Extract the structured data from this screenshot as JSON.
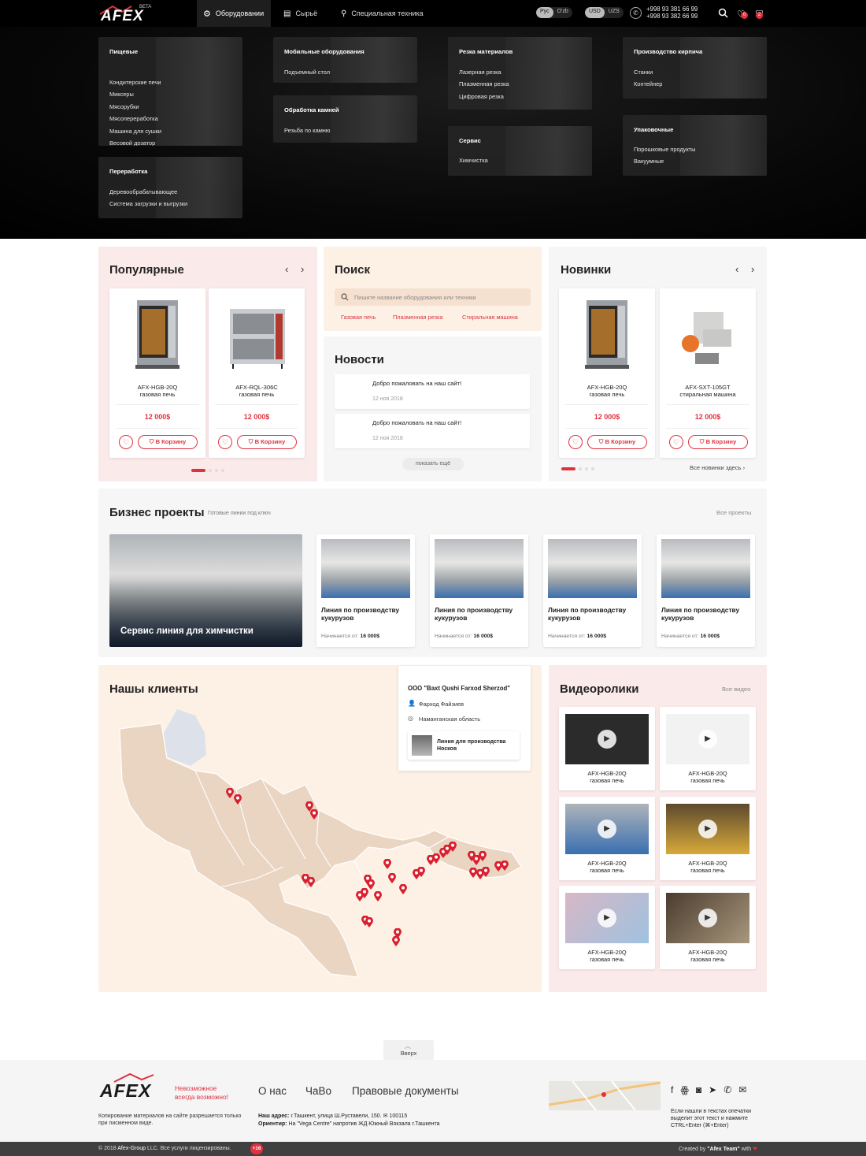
{
  "header": {
    "logo": "AFEX",
    "logo_badge": "BETA",
    "nav": [
      {
        "label": "Оборудовании",
        "icon": "equipment-icon"
      },
      {
        "label": "Сырьё",
        "icon": "book-icon"
      },
      {
        "label": "Специальная техника",
        "icon": "tech-icon"
      }
    ],
    "lang": [
      "Рус",
      "O'zb"
    ],
    "currency": [
      "USD",
      "UZS"
    ],
    "phones": [
      "+998 93 381 66 99",
      "+998 93 382 66 99"
    ],
    "fav_count": "0",
    "cart_count": "2"
  },
  "mega_menu": [
    {
      "title": "Пищевые",
      "items": [
        "Кондитерские печи",
        "Миксеры",
        "Мясорубки",
        "Мясопереработка",
        "Машина для сушки",
        "Весовой дозатор"
      ]
    },
    {
      "title": "Переработка",
      "items": [
        "Деревообрабатывающее",
        "Система загрузки и выгрузки"
      ]
    },
    {
      "title": "Мобильные оборудования",
      "items": [
        "Подъемный стол"
      ]
    },
    {
      "title": "Обработка камней",
      "items": [
        "Резьба по камню"
      ]
    },
    {
      "title": "Резка материалов",
      "items": [
        "Лазерная резка",
        "Плазменная резка",
        "Цифровая резка"
      ]
    },
    {
      "title": "Сервис",
      "items": [
        "Химчистка"
      ]
    },
    {
      "title": "Производство кирпича",
      "items": [
        "Станки",
        "Контейнер"
      ]
    },
    {
      "title": "Упаковочные",
      "items": [
        "Порошковые продукты",
        "Вакуумные"
      ]
    }
  ],
  "popular": {
    "title": "Популярные",
    "products": [
      {
        "model": "AFX-HGB-20Q",
        "type": "газовая печь",
        "price": "12 000$",
        "cart": "В Корзину"
      },
      {
        "model": "AFX-RQL-306C",
        "type": "газовая печь",
        "price": "12 000$",
        "cart": "В Корзину"
      }
    ]
  },
  "search": {
    "title": "Поиск",
    "placeholder": "Пишите название оборудования или техники",
    "tags": [
      "Газовая печь",
      "Плазменная резка",
      "Стиральная машина"
    ]
  },
  "news": {
    "title": "Новости",
    "items": [
      {
        "title": "Добро пожаловать на наш сайт!",
        "date": "12 ноя 2018"
      },
      {
        "title": "Добро пожаловать на наш сайт!",
        "date": "12 ноя 2018"
      }
    ],
    "more": "показать ещё"
  },
  "new_items": {
    "title": "Новинки",
    "products": [
      {
        "model": "AFX-HGB-20Q",
        "type": "газовая печь",
        "price": "12 000$",
        "cart": "В Корзину"
      },
      {
        "model": "AFX-SXT-105GT",
        "type": "стиральная машина",
        "price": "12 000$",
        "cart": "В Корзину"
      }
    ],
    "all_link": "Все новинки здесь"
  },
  "business": {
    "title": "Бизнес проекты",
    "subtitle": "Готовые линии под ключ",
    "all_link": "Все проекты",
    "featured": "Сервис линия для химчистки",
    "projects": [
      {
        "title": "Линия по производству кукурузов",
        "price_label": "Начинается от:",
        "price": "16 000$"
      },
      {
        "title": "Линия по производству кукурузов",
        "price_label": "Начинается от:",
        "price": "16 000$"
      },
      {
        "title": "Линия по производству кукурузов",
        "price_label": "Начинается от:",
        "price": "16 000$"
      },
      {
        "title": "Линия по производству кукурузов",
        "price_label": "Начинается от:",
        "price": "16 000$"
      }
    ]
  },
  "clients": {
    "title": "Нашы клиенты",
    "popup": {
      "company": "ООО \"Baxt Qushi Farxod Sherzod\"",
      "person": "Фарход Файзиев",
      "region": "Наманганская область",
      "product": "Линия для производства Носков"
    }
  },
  "videos": {
    "title": "Видеоролики",
    "all_link": "Все видео",
    "items": [
      {
        "model": "AFX-HGB-20Q",
        "type": "газовая печь"
      },
      {
        "model": "AFX-HGB-20Q",
        "type": "газовая печь"
      },
      {
        "model": "AFX-HGB-20Q",
        "type": "газовая печь"
      },
      {
        "model": "AFX-HGB-20Q",
        "type": "газовая печь"
      },
      {
        "model": "AFX-HGB-20Q",
        "type": "газовая печь"
      },
      {
        "model": "AFX-HGB-20Q",
        "type": "газовая печь"
      }
    ]
  },
  "to_top": "Вверх",
  "footer": {
    "logo": "AFEX",
    "slogan": [
      "Невозможное",
      "всегда возможно!"
    ],
    "copy_note": "Копирование материалов на сайте разрешается только при писменном виде.",
    "links": [
      "О нас",
      "ЧаВо",
      "Правовые документы"
    ],
    "address_label": "Наш адрес:",
    "address": "г.Ташкент, улица Ш.Руставели, 150.",
    "postcode": "100115",
    "landmark_label": "Ориентир:",
    "landmark": "На \"Vega Centre\" напротив ЖД Южный Вокзала г.Ташкента",
    "typo_note": "Если нашли в текстах опечатки выделит этот текст и нажмите CTRL+Enter (⌘+Enter)",
    "copyright_pre": "© 2018",
    "copyright_brand": "Afex-Group",
    "copyright_post": "LLC. Все услуги лицензированы.",
    "age": "+16",
    "created_pre": "Created by",
    "created_brand": "\"Afex Team\"",
    "created_post": "with"
  },
  "colors": {
    "accent": "#e0313f",
    "panel_pink": "#fbeaea",
    "panel_peach": "#fdf1e6",
    "panel_grey": "#f6f6f6",
    "map_land": "#ead5c3"
  }
}
